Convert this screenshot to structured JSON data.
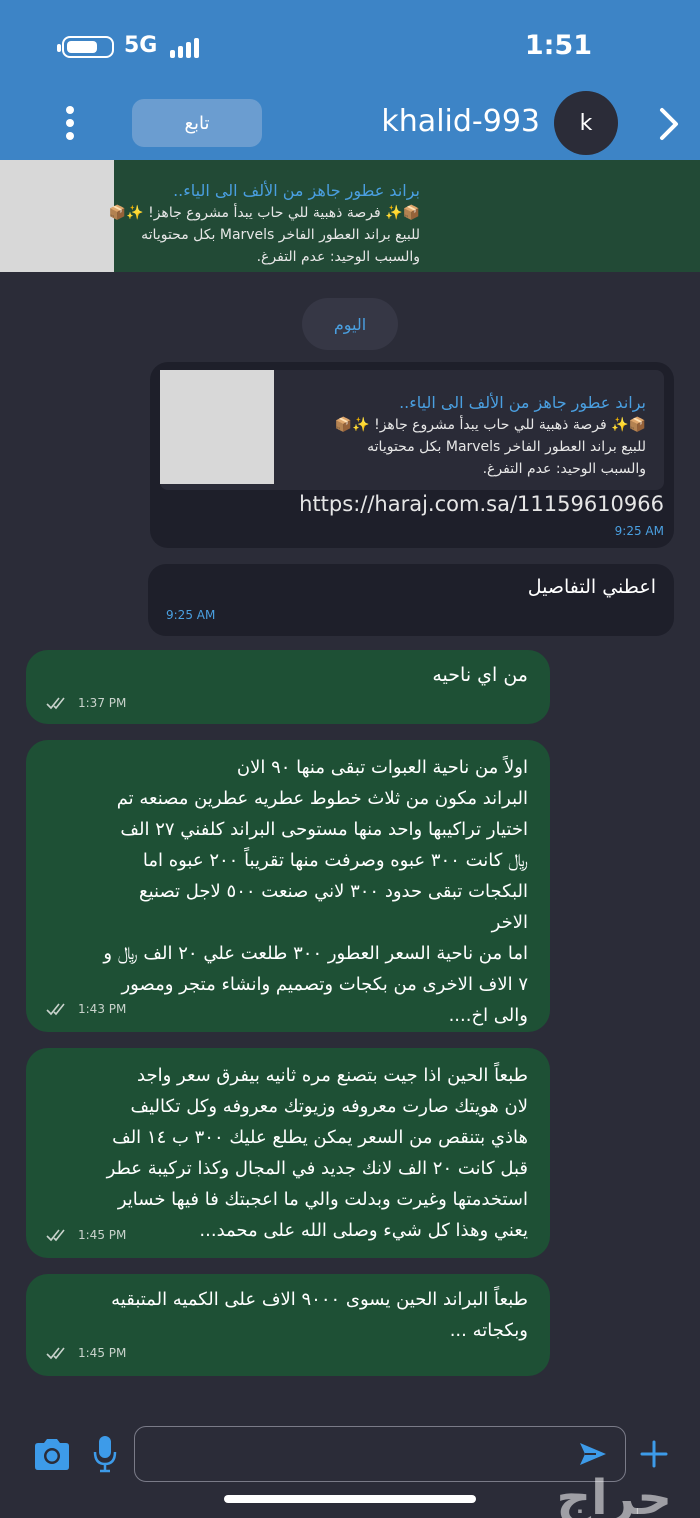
{
  "status_bar": {
    "time": "1:51",
    "network": "5G"
  },
  "header": {
    "username": "khalid-993",
    "avatar_letter": "k",
    "follow_label": "تابع"
  },
  "pinned_ad": {
    "title": "براند عطور جاهز من الألف الى الياء..",
    "line1": "📦✨ فرصة ذهبية للي حاب يبدأ مشروع جاهز! ✨📦",
    "line2": "للبيع براند العطور الفاخر Marvels بكل محتوياته",
    "line3": "والسبب الوحيد: عدم التفرغ."
  },
  "day_separator": "اليوم",
  "link_message": {
    "title": "براند عطور جاهز من الألف الى الياء..",
    "line1": "📦✨ فرصة ذهبية للي حاب يبدأ مشروع جاهز! ✨📦",
    "line2": "للبيع براند العطور الفاخر Marvels بكل محتوياته",
    "line3": "والسبب الوحيد: عدم التفرغ.",
    "url": "https://haraj.com.sa/11159610966",
    "time": "9:25 AM"
  },
  "incoming_message": {
    "text": "اعطني التفاصيل",
    "time": "9:25 AM"
  },
  "outgoing_messages": [
    {
      "lines": [
        "من اي ناحيه"
      ],
      "time": "1:37 PM"
    },
    {
      "lines": [
        "اولاً من ناحية العبوات تبقى منها ٩٠ الان",
        "البراند مكون من ثلاث خطوط عطريه  عطرين مصنعه تم",
        "اختيار تراكيبها واحد منها مستوحى البراند كلفني ٢٧ الف",
        "﷼ كانت ٣٠٠ عبوه وصرفت منها تقريباً ٢٠٠ عبوه اما",
        "البكجات تبقى حدود ٣٠٠ لاني صنعت ٥٠٠ لاجل تصنيع",
        "الاخر",
        "اما من ناحية السعر العطور ٣٠٠ طلعت علي ٢٠ الف ﷼ و",
        "٧ الاف الاخرى من بكجات وتصميم وانشاء متجر ومصور",
        "والى اخ...."
      ],
      "time": "1:43 PM"
    },
    {
      "lines": [
        "طبعاً الحين اذا جيت بتصنع مره ثانيه بيفرق سعر واجد",
        "لان هويتك صارت معروفه وزيوتك معروفه وكل تكاليف",
        "هاذي بتنقص من السعر يمكن يطلع عليك ٣٠٠  ب ١٤ الف",
        "قبل كانت ٢٠ الف لانك جديد في المجال وكذا تركيبة عطر",
        "استخدمتها وغيرت وبدلت والي ما اعجبتك فا فيها خساير",
        "يعني وهذا كل شيء وصلى الله على محمد..."
      ],
      "time": "1:45 PM"
    },
    {
      "lines": [
        "طبعاً البراند الحين  يسوى ٩٠٠٠ الاف على الكميه المتبقيه",
        "وبكجاته ..."
      ],
      "time": "1:45 PM"
    }
  ],
  "composer": {
    "placeholder": ""
  },
  "watermark": "حراج",
  "colors": {
    "header_bg": "#3d84c6",
    "chat_bg": "#2b2c38",
    "outgoing_bubble": "#1e5035",
    "incoming_bubble": "#1e1f2a",
    "accent": "#4a9fe0"
  }
}
